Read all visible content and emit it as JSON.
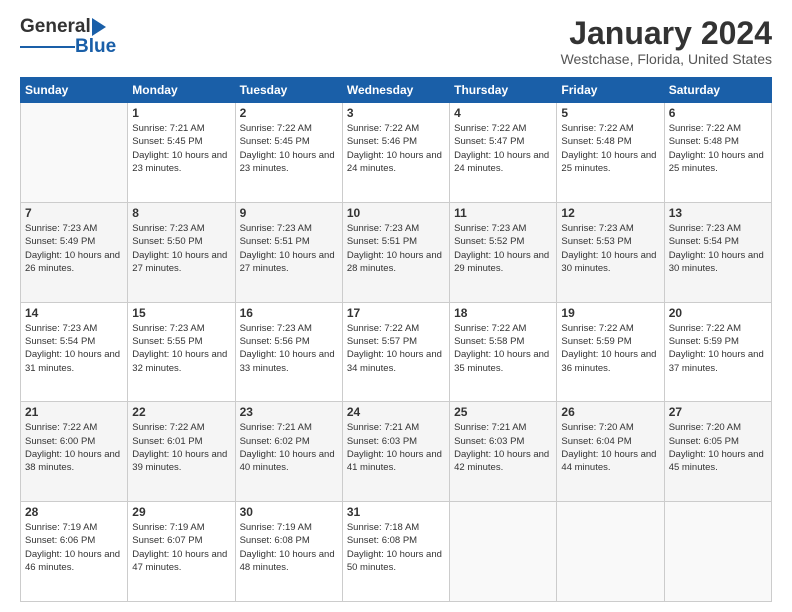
{
  "header": {
    "logo_general": "General",
    "logo_blue": "Blue",
    "main_title": "January 2024",
    "subtitle": "Westchase, Florida, United States"
  },
  "days_of_week": [
    "Sunday",
    "Monday",
    "Tuesday",
    "Wednesday",
    "Thursday",
    "Friday",
    "Saturday"
  ],
  "weeks": [
    [
      {
        "num": "",
        "sunrise": "",
        "sunset": "",
        "daylight": ""
      },
      {
        "num": "1",
        "sunrise": "Sunrise: 7:21 AM",
        "sunset": "Sunset: 5:45 PM",
        "daylight": "Daylight: 10 hours and 23 minutes."
      },
      {
        "num": "2",
        "sunrise": "Sunrise: 7:22 AM",
        "sunset": "Sunset: 5:45 PM",
        "daylight": "Daylight: 10 hours and 23 minutes."
      },
      {
        "num": "3",
        "sunrise": "Sunrise: 7:22 AM",
        "sunset": "Sunset: 5:46 PM",
        "daylight": "Daylight: 10 hours and 24 minutes."
      },
      {
        "num": "4",
        "sunrise": "Sunrise: 7:22 AM",
        "sunset": "Sunset: 5:47 PM",
        "daylight": "Daylight: 10 hours and 24 minutes."
      },
      {
        "num": "5",
        "sunrise": "Sunrise: 7:22 AM",
        "sunset": "Sunset: 5:48 PM",
        "daylight": "Daylight: 10 hours and 25 minutes."
      },
      {
        "num": "6",
        "sunrise": "Sunrise: 7:22 AM",
        "sunset": "Sunset: 5:48 PM",
        "daylight": "Daylight: 10 hours and 25 minutes."
      }
    ],
    [
      {
        "num": "7",
        "sunrise": "Sunrise: 7:23 AM",
        "sunset": "Sunset: 5:49 PM",
        "daylight": "Daylight: 10 hours and 26 minutes."
      },
      {
        "num": "8",
        "sunrise": "Sunrise: 7:23 AM",
        "sunset": "Sunset: 5:50 PM",
        "daylight": "Daylight: 10 hours and 27 minutes."
      },
      {
        "num": "9",
        "sunrise": "Sunrise: 7:23 AM",
        "sunset": "Sunset: 5:51 PM",
        "daylight": "Daylight: 10 hours and 27 minutes."
      },
      {
        "num": "10",
        "sunrise": "Sunrise: 7:23 AM",
        "sunset": "Sunset: 5:51 PM",
        "daylight": "Daylight: 10 hours and 28 minutes."
      },
      {
        "num": "11",
        "sunrise": "Sunrise: 7:23 AM",
        "sunset": "Sunset: 5:52 PM",
        "daylight": "Daylight: 10 hours and 29 minutes."
      },
      {
        "num": "12",
        "sunrise": "Sunrise: 7:23 AM",
        "sunset": "Sunset: 5:53 PM",
        "daylight": "Daylight: 10 hours and 30 minutes."
      },
      {
        "num": "13",
        "sunrise": "Sunrise: 7:23 AM",
        "sunset": "Sunset: 5:54 PM",
        "daylight": "Daylight: 10 hours and 30 minutes."
      }
    ],
    [
      {
        "num": "14",
        "sunrise": "Sunrise: 7:23 AM",
        "sunset": "Sunset: 5:54 PM",
        "daylight": "Daylight: 10 hours and 31 minutes."
      },
      {
        "num": "15",
        "sunrise": "Sunrise: 7:23 AM",
        "sunset": "Sunset: 5:55 PM",
        "daylight": "Daylight: 10 hours and 32 minutes."
      },
      {
        "num": "16",
        "sunrise": "Sunrise: 7:23 AM",
        "sunset": "Sunset: 5:56 PM",
        "daylight": "Daylight: 10 hours and 33 minutes."
      },
      {
        "num": "17",
        "sunrise": "Sunrise: 7:22 AM",
        "sunset": "Sunset: 5:57 PM",
        "daylight": "Daylight: 10 hours and 34 minutes."
      },
      {
        "num": "18",
        "sunrise": "Sunrise: 7:22 AM",
        "sunset": "Sunset: 5:58 PM",
        "daylight": "Daylight: 10 hours and 35 minutes."
      },
      {
        "num": "19",
        "sunrise": "Sunrise: 7:22 AM",
        "sunset": "Sunset: 5:59 PM",
        "daylight": "Daylight: 10 hours and 36 minutes."
      },
      {
        "num": "20",
        "sunrise": "Sunrise: 7:22 AM",
        "sunset": "Sunset: 5:59 PM",
        "daylight": "Daylight: 10 hours and 37 minutes."
      }
    ],
    [
      {
        "num": "21",
        "sunrise": "Sunrise: 7:22 AM",
        "sunset": "Sunset: 6:00 PM",
        "daylight": "Daylight: 10 hours and 38 minutes."
      },
      {
        "num": "22",
        "sunrise": "Sunrise: 7:22 AM",
        "sunset": "Sunset: 6:01 PM",
        "daylight": "Daylight: 10 hours and 39 minutes."
      },
      {
        "num": "23",
        "sunrise": "Sunrise: 7:21 AM",
        "sunset": "Sunset: 6:02 PM",
        "daylight": "Daylight: 10 hours and 40 minutes."
      },
      {
        "num": "24",
        "sunrise": "Sunrise: 7:21 AM",
        "sunset": "Sunset: 6:03 PM",
        "daylight": "Daylight: 10 hours and 41 minutes."
      },
      {
        "num": "25",
        "sunrise": "Sunrise: 7:21 AM",
        "sunset": "Sunset: 6:03 PM",
        "daylight": "Daylight: 10 hours and 42 minutes."
      },
      {
        "num": "26",
        "sunrise": "Sunrise: 7:20 AM",
        "sunset": "Sunset: 6:04 PM",
        "daylight": "Daylight: 10 hours and 44 minutes."
      },
      {
        "num": "27",
        "sunrise": "Sunrise: 7:20 AM",
        "sunset": "Sunset: 6:05 PM",
        "daylight": "Daylight: 10 hours and 45 minutes."
      }
    ],
    [
      {
        "num": "28",
        "sunrise": "Sunrise: 7:19 AM",
        "sunset": "Sunset: 6:06 PM",
        "daylight": "Daylight: 10 hours and 46 minutes."
      },
      {
        "num": "29",
        "sunrise": "Sunrise: 7:19 AM",
        "sunset": "Sunset: 6:07 PM",
        "daylight": "Daylight: 10 hours and 47 minutes."
      },
      {
        "num": "30",
        "sunrise": "Sunrise: 7:19 AM",
        "sunset": "Sunset: 6:08 PM",
        "daylight": "Daylight: 10 hours and 48 minutes."
      },
      {
        "num": "31",
        "sunrise": "Sunrise: 7:18 AM",
        "sunset": "Sunset: 6:08 PM",
        "daylight": "Daylight: 10 hours and 50 minutes."
      },
      {
        "num": "",
        "sunrise": "",
        "sunset": "",
        "daylight": ""
      },
      {
        "num": "",
        "sunrise": "",
        "sunset": "",
        "daylight": ""
      },
      {
        "num": "",
        "sunrise": "",
        "sunset": "",
        "daylight": ""
      }
    ]
  ]
}
